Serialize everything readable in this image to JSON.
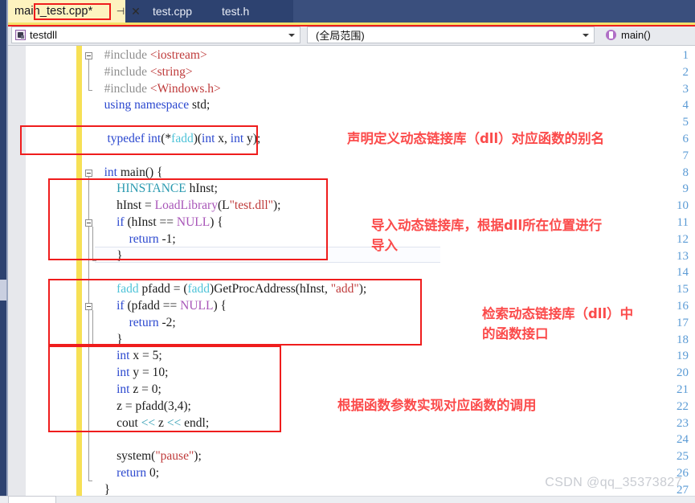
{
  "window": {
    "watermark": "CSDN @qq_35373827"
  },
  "tabs": {
    "active": {
      "label": "main_test.cpp*",
      "pin_icon": "pin-icon",
      "close_icon": "close-icon"
    },
    "others": [
      {
        "label": "test.cpp"
      },
      {
        "label": "test.h"
      }
    ]
  },
  "navbar": {
    "project": "testdll",
    "project_icon": "project-icon",
    "scope": "(全局范围)",
    "member": "main()",
    "member_icon": "method-icon",
    "dropdown_icon": "chevron-down-icon"
  },
  "editor": {
    "line_numbers": [
      1,
      2,
      3,
      4,
      5,
      6,
      7,
      8,
      9,
      10,
      11,
      12,
      13,
      14,
      15,
      16,
      17,
      18,
      19,
      20,
      21,
      22,
      23,
      24,
      25,
      26,
      27
    ],
    "lines": [
      {
        "n": 1,
        "text": "#include <iostream>"
      },
      {
        "n": 2,
        "text": "#include <string>"
      },
      {
        "n": 3,
        "text": "#include <Windows.h>"
      },
      {
        "n": 4,
        "text": "using namespace std;"
      },
      {
        "n": 5,
        "text": ""
      },
      {
        "n": 6,
        "text": "typedef int(*fadd)(int x, int y);"
      },
      {
        "n": 7,
        "text": ""
      },
      {
        "n": 8,
        "text": "int main() {"
      },
      {
        "n": 9,
        "text": "    HINSTANCE hInst;"
      },
      {
        "n": 10,
        "text": "    hInst = LoadLibrary(L\"test.dll\");"
      },
      {
        "n": 11,
        "text": "    if (hInst == NULL) {"
      },
      {
        "n": 12,
        "text": "        return -1;"
      },
      {
        "n": 13,
        "text": "    }"
      },
      {
        "n": 14,
        "text": ""
      },
      {
        "n": 15,
        "text": "    fadd pfadd = (fadd)GetProcAddress(hInst, \"add\");"
      },
      {
        "n": 16,
        "text": "    if (pfadd == NULL) {"
      },
      {
        "n": 17,
        "text": "        return -2;"
      },
      {
        "n": 18,
        "text": "    }"
      },
      {
        "n": 19,
        "text": "    int x = 5;"
      },
      {
        "n": 20,
        "text": "    int y = 10;"
      },
      {
        "n": 21,
        "text": "    int z = 0;"
      },
      {
        "n": 22,
        "text": "    z = pfadd(3,4);"
      },
      {
        "n": 23,
        "text": "    cout << z << endl;"
      },
      {
        "n": 24,
        "text": ""
      },
      {
        "n": 25,
        "text": "    system(\"pause\");"
      },
      {
        "n": 26,
        "text": "    return 0;"
      },
      {
        "n": 27,
        "text": "}"
      }
    ]
  },
  "annotations": [
    {
      "id": "note-typedef",
      "text": "声明定义动态链接库（dll）对应函数的别名"
    },
    {
      "id": "note-loadlibrary",
      "text": "导入动态链接库，根据dll所在位置进行\n导入"
    },
    {
      "id": "note-getprocaddress",
      "text": "检索动态链接库（dll）中\n的函数接口"
    },
    {
      "id": "note-call",
      "text": "根据函数参数实现对应函数的调用"
    }
  ],
  "colors": {
    "accent_red": "#ef1d1d",
    "note_red": "#fb4b4b",
    "tab_active_bg": "#fdf3bf",
    "tabstrip_bg": "#2d4270",
    "change_bar": "#f7e055",
    "linenum": "#5b9bd5"
  }
}
